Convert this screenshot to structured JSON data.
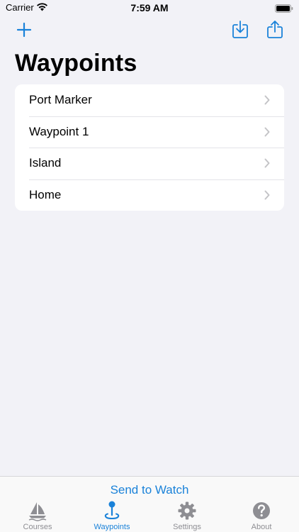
{
  "status_bar": {
    "carrier": "Carrier",
    "time": "7:59 AM"
  },
  "nav": {
    "add_icon": "plus-icon",
    "import_icon": "tray-arrow-down-icon",
    "share_icon": "share-icon",
    "accent_color": "#1a82d9"
  },
  "page": {
    "title": "Waypoints"
  },
  "waypoints": [
    {
      "name": "Port Marker"
    },
    {
      "name": "Waypoint 1"
    },
    {
      "name": "Island"
    },
    {
      "name": "Home"
    }
  ],
  "toolbar": {
    "send_label": "Send to Watch"
  },
  "tabs": [
    {
      "label": "Courses",
      "icon": "sailboat-icon",
      "active": false
    },
    {
      "label": "Waypoints",
      "icon": "map-pin-icon",
      "active": true
    },
    {
      "label": "Settings",
      "icon": "gear-icon",
      "active": false
    },
    {
      "label": "About",
      "icon": "question-mark-circle-icon",
      "active": false
    }
  ]
}
